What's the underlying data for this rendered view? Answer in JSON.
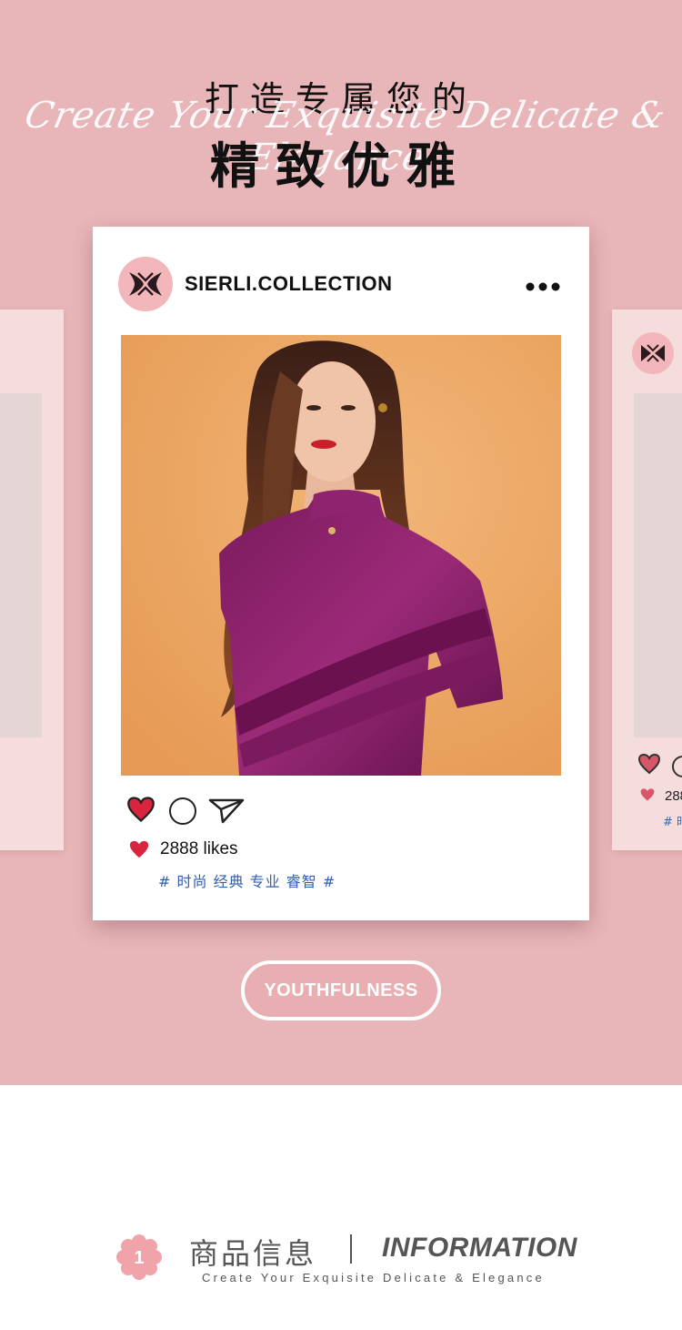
{
  "header": {
    "headline_cn": "打造专属您的",
    "script_en": "Create Your Exquisite Delicate & Elegance",
    "headline_cn_large": "精致优雅"
  },
  "post": {
    "account_name": "SIERLI.COLLECTION",
    "more_icon": "more-horizontal-icon",
    "photo": "model-in-purple-dress-photo",
    "likes": "2888 likes",
    "hashtags": "# 时尚 经典 专业 睿智 #"
  },
  "side_card_right": {
    "likes": "288",
    "tags": "# 时"
  },
  "cta": {
    "label": "YOUTHFULNESS"
  },
  "section": {
    "number": "1",
    "title_cn": "商品信息",
    "title_en": "INFORMATION",
    "subtitle": "Create Your Exquisite Delicate & Elegance"
  },
  "colors": {
    "background_pink": "#e8b6b8",
    "card_white": "#ffffff",
    "heart_red": "#d8243f",
    "hashtag_blue": "#2f5fb0",
    "logo_pink": "#f3b6ba"
  }
}
